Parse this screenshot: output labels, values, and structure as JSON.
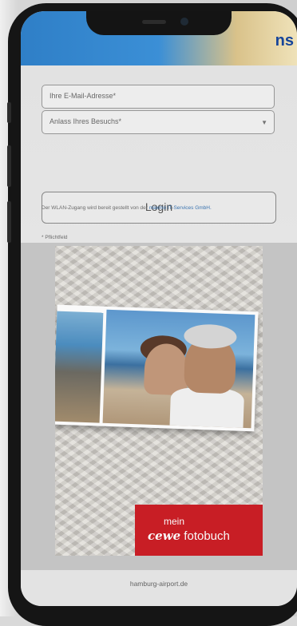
{
  "banner": {
    "text": "ns"
  },
  "form": {
    "email_placeholder": "Ihre E-Mail-Adresse*",
    "reason_placeholder": "Anlass Ihres Besuchs*",
    "login_label": "Login",
    "required_note": "* Pflichtfeld",
    "info_text": "Der WLAN-Zugang wird bereit gestellt von der ",
    "provider_link": "maxmo IT-Services GmbH."
  },
  "ad": {
    "badge_line1": "mein",
    "badge_brand": "cewe",
    "badge_product": " fotobuch",
    "brand_color": "#cc1f26"
  },
  "footer": {
    "url": "hamburg-airport.de"
  }
}
